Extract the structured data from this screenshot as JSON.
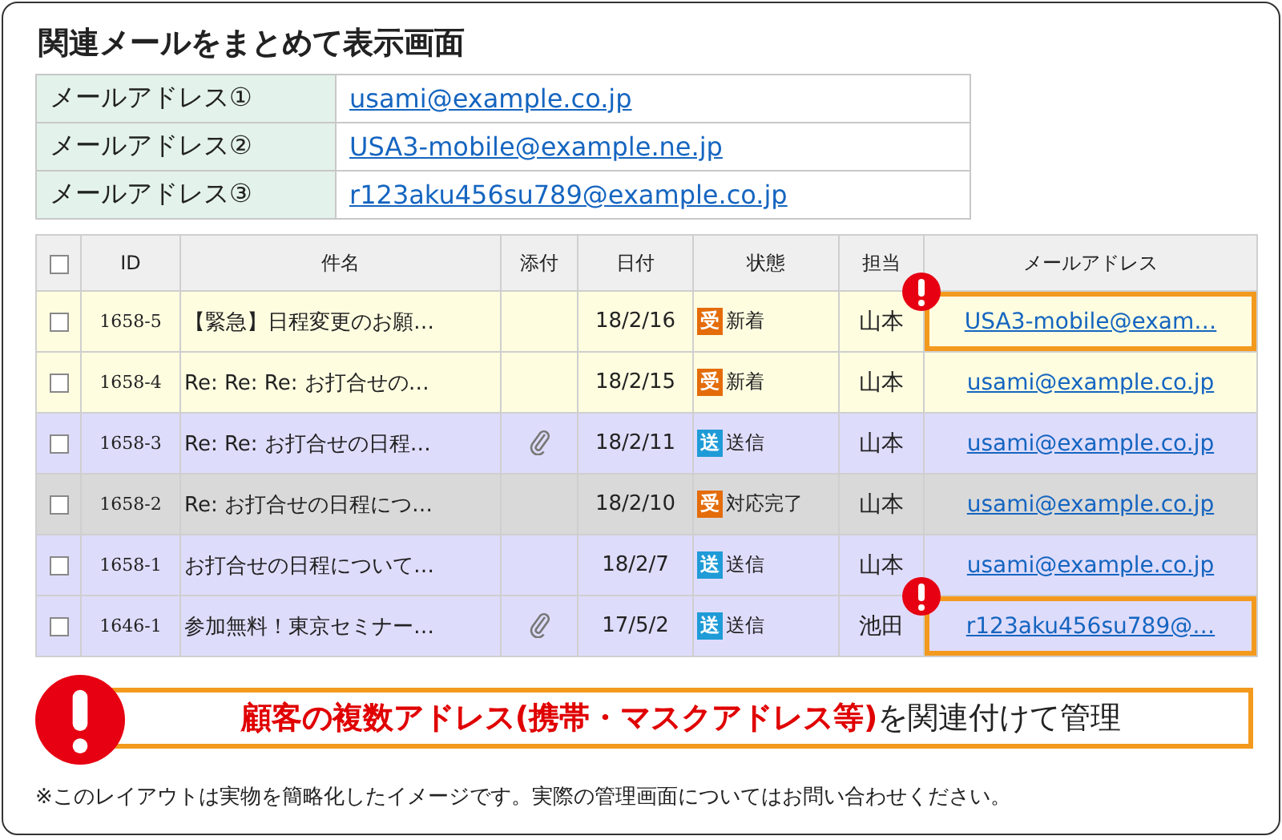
{
  "title": "関連メールをまとめて表示画面",
  "addresses": [
    {
      "label": "メールアドレス①",
      "value": "usami@example.co.jp"
    },
    {
      "label": "メールアドレス②",
      "value": "USA3-mobile@example.ne.jp"
    },
    {
      "label": "メールアドレス③",
      "value": "r123aku456su789@example.co.jp"
    }
  ],
  "table": {
    "header_checked": false,
    "columns": [
      "ID",
      "件名",
      "添付",
      "日付",
      "状態",
      "担当",
      "メールアドレス"
    ],
    "rows": [
      {
        "kind": "new",
        "checked": false,
        "id": "1658-5",
        "subject": "【緊急】日程変更のお願…",
        "attachment": false,
        "date": "18/2/16",
        "status_badge": {
          "kind": "received",
          "text": "受"
        },
        "status": "新着",
        "owner": "山本",
        "email": "USA3-mobile@exam…",
        "highlighted": true
      },
      {
        "kind": "new",
        "checked": false,
        "id": "1658-4",
        "subject": "Re: Re: Re: お打合せの…",
        "attachment": false,
        "date": "18/2/15",
        "status_badge": {
          "kind": "received",
          "text": "受"
        },
        "status": "新着",
        "owner": "山本",
        "email": "usami@example.co.jp",
        "highlighted": false
      },
      {
        "kind": "sent",
        "checked": false,
        "id": "1658-3",
        "subject": "Re: Re: お打合せの日程…",
        "attachment": true,
        "date": "18/2/11",
        "status_badge": {
          "kind": "sent",
          "text": "送"
        },
        "status": "送信",
        "owner": "山本",
        "email": "usami@example.co.jp",
        "highlighted": false
      },
      {
        "kind": "done",
        "checked": false,
        "id": "1658-2",
        "subject": "Re: お打合せの日程につ…",
        "attachment": false,
        "date": "18/2/10",
        "status_badge": {
          "kind": "received",
          "text": "受"
        },
        "status": "対応完了",
        "owner": "山本",
        "email": "usami@example.co.jp",
        "highlighted": false
      },
      {
        "kind": "sent",
        "checked": false,
        "id": "1658-1",
        "subject": "お打合せの日程について…",
        "attachment": false,
        "date": "18/2/7",
        "status_badge": {
          "kind": "sent",
          "text": "送"
        },
        "status": "送信",
        "owner": "山本",
        "email": "usami@example.co.jp",
        "highlighted": false
      },
      {
        "kind": "sent",
        "checked": false,
        "id": "1646-1",
        "subject": "参加無料！東京セミナー…",
        "attachment": true,
        "date": "17/5/2",
        "status_badge": {
          "kind": "sent",
          "text": "送"
        },
        "status": "送信",
        "owner": "池田",
        "email": "r123aku456su789@…",
        "highlighted": true
      }
    ]
  },
  "banner": "**顧客の複数アドレス(携帯・マスクアドレス等)**を関連付けて管理",
  "footnote": "※このレイアウトは実物を簡略化したイメージです。実際の管理画面についてはお問い合わせください。"
}
